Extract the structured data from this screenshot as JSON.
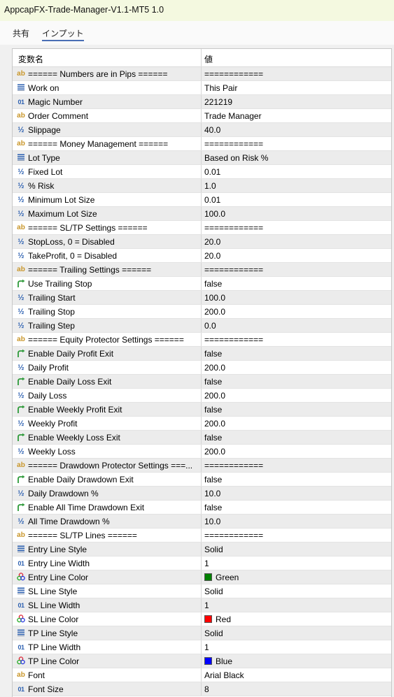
{
  "window": {
    "title": "AppcapFX-Trade-Manager-V1.1-MT5 1.0"
  },
  "tabs": [
    {
      "label": "共有",
      "active": false
    },
    {
      "label": "インプット",
      "active": true
    }
  ],
  "table": {
    "headers": {
      "name": "変数名",
      "value": "値"
    },
    "rows": [
      {
        "icon": "ab-string-icon",
        "name": "====== Numbers are in Pips ======",
        "value": "============"
      },
      {
        "icon": "enum-icon",
        "name": "Work on",
        "value": "This Pair"
      },
      {
        "icon": "int-icon",
        "name": "Magic Number",
        "value": "221219"
      },
      {
        "icon": "ab-string-icon",
        "name": "Order Comment",
        "value": "Trade Manager"
      },
      {
        "icon": "double-icon",
        "name": "Slippage",
        "value": "40.0"
      },
      {
        "icon": "ab-string-icon",
        "name": "====== Money Management ======",
        "value": "============"
      },
      {
        "icon": "enum-icon",
        "name": "Lot Type",
        "value": "Based on Risk %"
      },
      {
        "icon": "double-icon",
        "name": "Fixed Lot",
        "value": "0.01"
      },
      {
        "icon": "double-icon",
        "name": "% Risk",
        "value": "1.0"
      },
      {
        "icon": "double-icon",
        "name": "Minimum Lot Size",
        "value": "0.01"
      },
      {
        "icon": "double-icon",
        "name": "Maximum Lot Size",
        "value": "100.0"
      },
      {
        "icon": "ab-string-icon",
        "name": "====== SL/TP Settings ======",
        "value": "============"
      },
      {
        "icon": "double-icon",
        "name": "StopLoss, 0 = Disabled",
        "value": "20.0"
      },
      {
        "icon": "double-icon",
        "name": "TakeProfit, 0 = Disabled",
        "value": "20.0"
      },
      {
        "icon": "ab-string-icon",
        "name": "====== Trailing Settings ======",
        "value": "============"
      },
      {
        "icon": "bool-icon",
        "name": "Use Trailing Stop",
        "value": "false"
      },
      {
        "icon": "double-icon",
        "name": "Trailing Start",
        "value": "100.0"
      },
      {
        "icon": "double-icon",
        "name": "Trailing Stop",
        "value": "200.0"
      },
      {
        "icon": "double-icon",
        "name": "Trailing Step",
        "value": "0.0"
      },
      {
        "icon": "ab-string-icon",
        "name": "====== Equity Protector Settings ======",
        "value": "============"
      },
      {
        "icon": "bool-icon",
        "name": "Enable Daily Profit Exit",
        "value": "false"
      },
      {
        "icon": "double-icon",
        "name": "Daily Profit",
        "value": "200.0"
      },
      {
        "icon": "bool-icon",
        "name": "Enable Daily Loss Exit",
        "value": "false"
      },
      {
        "icon": "double-icon",
        "name": "Daily Loss",
        "value": "200.0"
      },
      {
        "icon": "bool-icon",
        "name": "Enable Weekly Profit Exit",
        "value": "false"
      },
      {
        "icon": "double-icon",
        "name": "Weekly Profit",
        "value": "200.0"
      },
      {
        "icon": "bool-icon",
        "name": "Enable Weekly Loss Exit",
        "value": "false"
      },
      {
        "icon": "double-icon",
        "name": "Weekly Loss",
        "value": "200.0"
      },
      {
        "icon": "ab-string-icon",
        "name": "====== Drawdown Protector Settings ===...",
        "value": "============"
      },
      {
        "icon": "bool-icon",
        "name": "Enable Daily Drawdown Exit",
        "value": "false"
      },
      {
        "icon": "double-icon",
        "name": "Daily Drawdown %",
        "value": "10.0"
      },
      {
        "icon": "bool-icon",
        "name": "Enable All Time Drawdown Exit",
        "value": "false"
      },
      {
        "icon": "double-icon",
        "name": "All Time Drawdown %",
        "value": "10.0"
      },
      {
        "icon": "ab-string-icon",
        "name": "====== SL/TP Lines ======",
        "value": "============"
      },
      {
        "icon": "enum-icon",
        "name": "Entry Line Style",
        "value": "Solid"
      },
      {
        "icon": "int-icon",
        "name": "Entry Line Width",
        "value": "1"
      },
      {
        "icon": "color-icon",
        "name": "Entry Line Color",
        "value": "Green",
        "swatch": "#008000"
      },
      {
        "icon": "enum-icon",
        "name": "SL Line Style",
        "value": "Solid"
      },
      {
        "icon": "int-icon",
        "name": "SL Line Width",
        "value": "1"
      },
      {
        "icon": "color-icon",
        "name": "SL Line Color",
        "value": "Red",
        "swatch": "#ff0000"
      },
      {
        "icon": "enum-icon",
        "name": "TP Line Style",
        "value": "Solid"
      },
      {
        "icon": "int-icon",
        "name": "TP Line Width",
        "value": "1"
      },
      {
        "icon": "color-icon",
        "name": "TP Line Color",
        "value": "Blue",
        "swatch": "#0000ff"
      },
      {
        "icon": "ab-string-icon",
        "name": "Font",
        "value": "Arial Black"
      },
      {
        "icon": "int-icon",
        "name": "Font Size",
        "value": "8"
      }
    ]
  },
  "colors": {
    "title_bar": "#f4f9e0",
    "alt_row": "#ececec",
    "tab_underline": "#4a6fb5",
    "string_icon": "#c9962a",
    "numeric_icon": "#2b5fb0",
    "bool_icon": "#2e9a3a"
  }
}
